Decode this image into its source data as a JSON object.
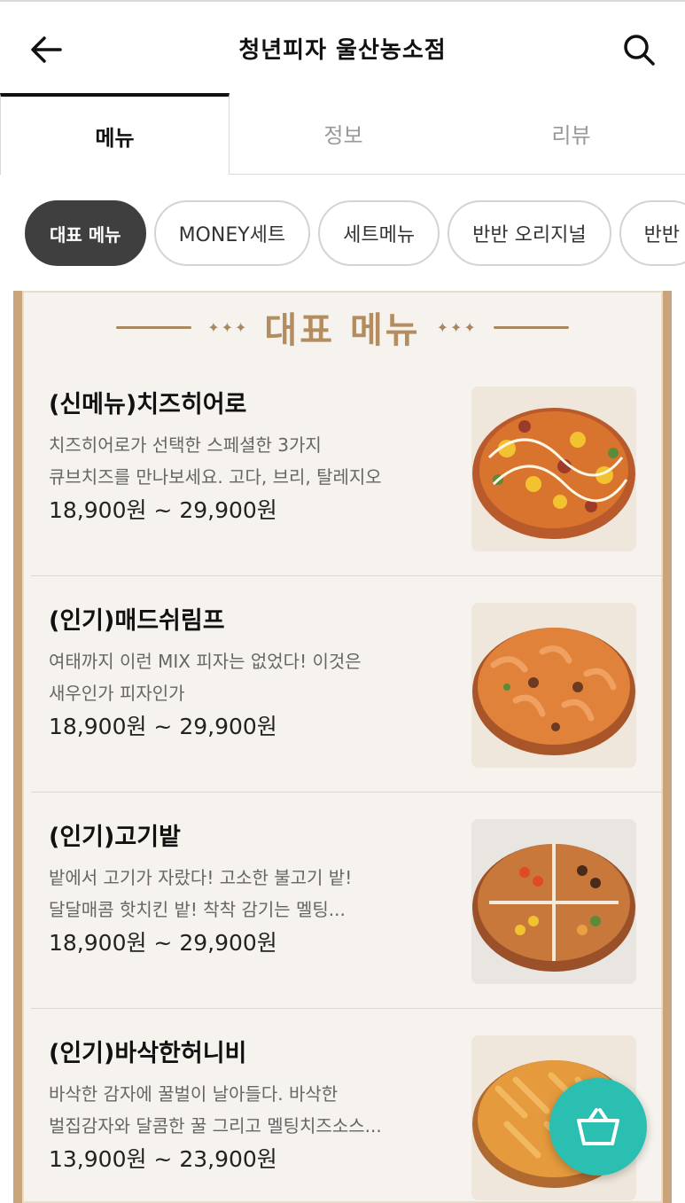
{
  "header": {
    "title": "청년피자 울산농소점"
  },
  "tabs": [
    {
      "label": "메뉴",
      "active": true
    },
    {
      "label": "정보",
      "active": false
    },
    {
      "label": "리뷰",
      "active": false
    }
  ],
  "categories": [
    {
      "label": "대표 메뉴",
      "active": true
    },
    {
      "label": "MONEY세트",
      "active": false
    },
    {
      "label": "세트메뉴",
      "active": false
    },
    {
      "label": "반반 오리지널",
      "active": false
    },
    {
      "label": "반반",
      "active": false
    }
  ],
  "section": {
    "title": "대표 메뉴",
    "decoration": "✦✦✦"
  },
  "items": [
    {
      "name": "(신메뉴)치즈히어로",
      "desc_line1": "치즈히어로가 선택한 스페셜한 3가지",
      "desc_line2": "큐브치즈를 만나보세요. 고다, 브리, 탈레지오",
      "price": "18,900원 ~ 29,900원"
    },
    {
      "name": "(인기)매드쉬림프",
      "desc_line1": "여태까지 이런 MIX 피자는 없었다! 이것은",
      "desc_line2": "새우인가 피자인가",
      "price": "18,900원 ~ 29,900원"
    },
    {
      "name": "(인기)고기밭",
      "desc_line1": "밭에서 고기가 자랐다! 고소한 불고기 밭!",
      "desc_line2": "달달매콤 핫치킨 밭! 착착 감기는 멜팅...",
      "price": "18,900원 ~ 29,900원"
    },
    {
      "name": "(인기)바삭한허니비",
      "desc_line1": "바삭한 감자에 꿀벌이 날아들다. 바삭한",
      "desc_line2": "벌집감자와 달콤한 꿀 그리고 멜팅치즈소스...",
      "price": "13,900원 ~ 23,900원"
    }
  ],
  "icons": {
    "back": "arrow-left-icon",
    "search": "search-icon",
    "cart": "basket-icon"
  },
  "colors": {
    "accent": "#2bbfb1",
    "active_chip": "#3f3f3f",
    "board_border": "#c9a37a",
    "section_title": "#b38d5f"
  }
}
